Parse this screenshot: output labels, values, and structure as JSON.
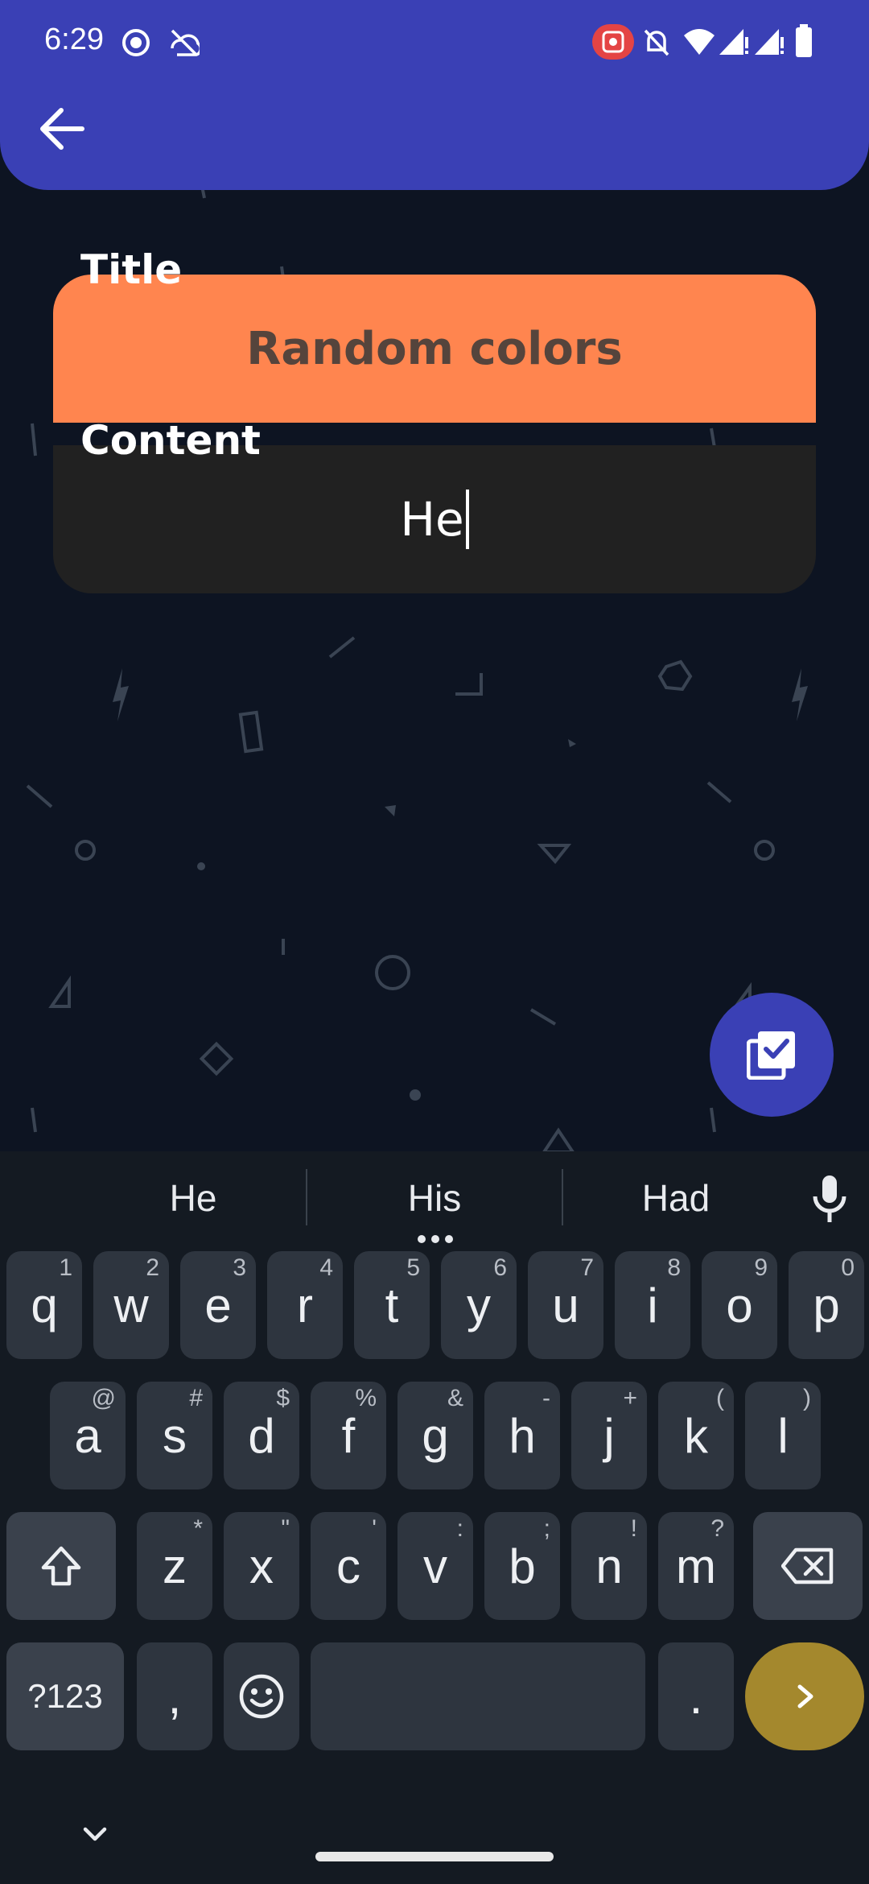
{
  "status_bar": {
    "time": "6:29",
    "icons": [
      "screen-record-icon",
      "sync-off-icon",
      "cast-icon",
      "mute-icon",
      "wifi-icon",
      "signal-icon",
      "signal-icon",
      "battery-icon"
    ]
  },
  "app_bar": {
    "back_icon": "arrow-left-icon",
    "color": "#3a40b5"
  },
  "form": {
    "title_label": "Title",
    "title_value": "Random colors",
    "title_color": "#ff854f",
    "content_label": "Content",
    "content_value": "He"
  },
  "fab": {
    "icon": "save-notes-icon"
  },
  "keyboard": {
    "suggestions": [
      "He",
      "His",
      "Had"
    ],
    "row1": [
      {
        "k": "q",
        "h": "1"
      },
      {
        "k": "w",
        "h": "2"
      },
      {
        "k": "e",
        "h": "3"
      },
      {
        "k": "r",
        "h": "4"
      },
      {
        "k": "t",
        "h": "5"
      },
      {
        "k": "y",
        "h": "6"
      },
      {
        "k": "u",
        "h": "7"
      },
      {
        "k": "i",
        "h": "8"
      },
      {
        "k": "o",
        "h": "9"
      },
      {
        "k": "p",
        "h": "0"
      }
    ],
    "row2": [
      {
        "k": "a",
        "h": "@"
      },
      {
        "k": "s",
        "h": "#"
      },
      {
        "k": "d",
        "h": "$"
      },
      {
        "k": "f",
        "h": "%"
      },
      {
        "k": "g",
        "h": "&"
      },
      {
        "k": "h",
        "h": "-"
      },
      {
        "k": "j",
        "h": "+"
      },
      {
        "k": "k",
        "h": "("
      },
      {
        "k": "l",
        "h": ")"
      }
    ],
    "row3": [
      {
        "k": "z",
        "h": "*"
      },
      {
        "k": "x",
        "h": "\""
      },
      {
        "k": "c",
        "h": "'"
      },
      {
        "k": "v",
        "h": ":"
      },
      {
        "k": "b",
        "h": ";"
      },
      {
        "k": "n",
        "h": "!"
      },
      {
        "k": "m",
        "h": "?"
      }
    ],
    "symbols_key": "?123",
    "comma_key": ",",
    "period_key": ".",
    "enter_color": "#a4882d"
  }
}
